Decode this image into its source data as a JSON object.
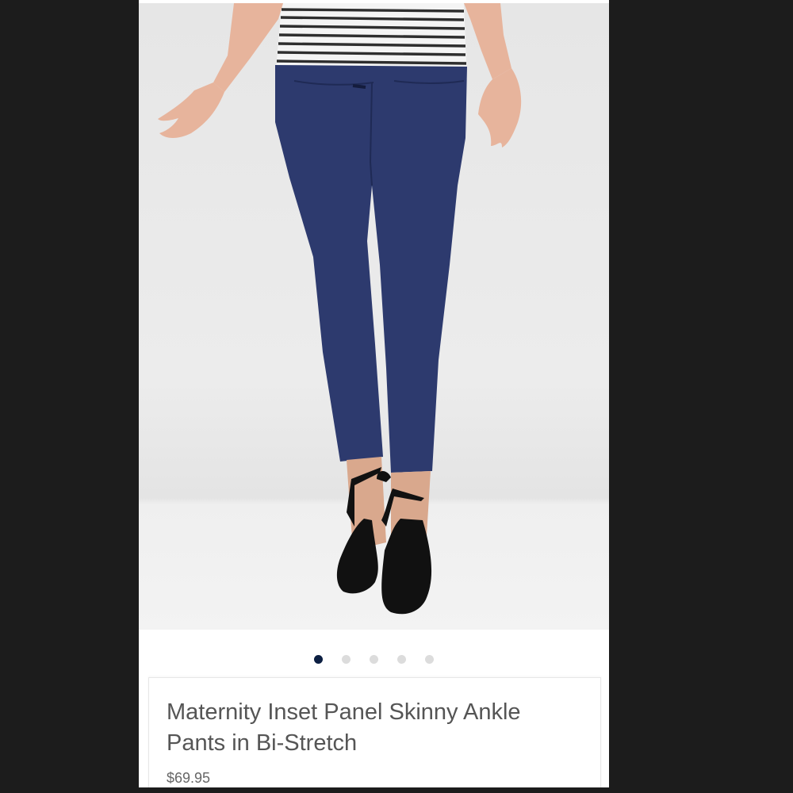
{
  "product": {
    "title": "Maternity Inset Panel Skinny Ankle Pants in Bi-Stretch",
    "price": "$69.95",
    "image_alt": "model-wearing-navy-ankle-pants"
  },
  "carousel": {
    "total_slides": 5,
    "active_index": 0
  },
  "colors": {
    "pants": "#2d3a6e",
    "active_dot": "#0c1f42",
    "inactive_dot": "#dcdcdc"
  }
}
